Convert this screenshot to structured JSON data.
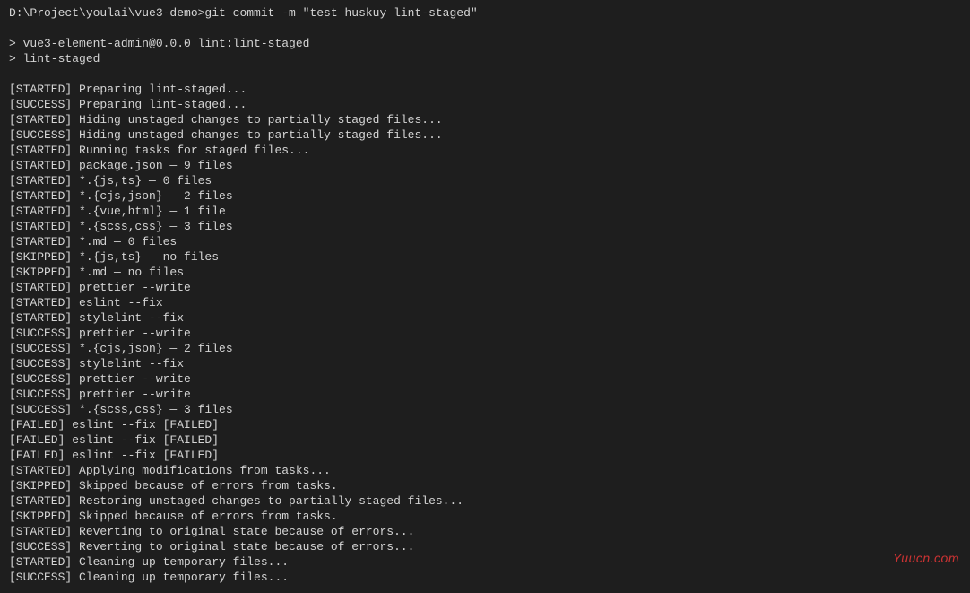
{
  "prompt": "D:\\Project\\youlai\\vue3-demo>git commit -m \"test huskuy lint-staged\"",
  "script_lines": [
    "> vue3-element-admin@0.0.0 lint:lint-staged",
    "> lint-staged"
  ],
  "log_lines": [
    "[STARTED] Preparing lint-staged...",
    "[SUCCESS] Preparing lint-staged...",
    "[STARTED] Hiding unstaged changes to partially staged files...",
    "[SUCCESS] Hiding unstaged changes to partially staged files...",
    "[STARTED] Running tasks for staged files...",
    "[STARTED] package.json — 9 files",
    "[STARTED] *.{js,ts} — 0 files",
    "[STARTED] *.{cjs,json} — 2 files",
    "[STARTED] *.{vue,html} — 1 file",
    "[STARTED] *.{scss,css} — 3 files",
    "[STARTED] *.md — 0 files",
    "[SKIPPED] *.{js,ts} — no files",
    "[SKIPPED] *.md — no files",
    "[STARTED] prettier --write",
    "[STARTED] eslint --fix",
    "[STARTED] stylelint --fix",
    "[SUCCESS] prettier --write",
    "[SUCCESS] *.{cjs,json} — 2 files",
    "[SUCCESS] stylelint --fix",
    "[SUCCESS] prettier --write",
    "[SUCCESS] prettier --write",
    "[SUCCESS] *.{scss,css} — 3 files",
    "[FAILED] eslint --fix [FAILED]",
    "[FAILED] eslint --fix [FAILED]",
    "[FAILED] eslint --fix [FAILED]",
    "[STARTED] Applying modifications from tasks...",
    "[SKIPPED] Skipped because of errors from tasks.",
    "[STARTED] Restoring unstaged changes to partially staged files...",
    "[SKIPPED] Skipped because of errors from tasks.",
    "[STARTED] Reverting to original state because of errors...",
    "[SUCCESS] Reverting to original state because of errors...",
    "[STARTED] Cleaning up temporary files...",
    "[SUCCESS] Cleaning up temporary files..."
  ],
  "watermark": "Yuucn.com"
}
